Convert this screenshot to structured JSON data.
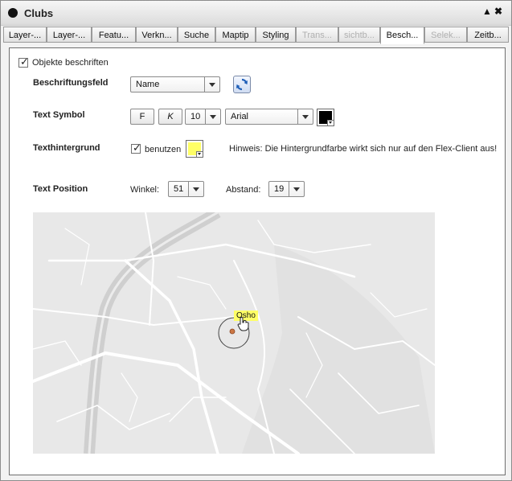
{
  "window": {
    "title": "Clubs",
    "btn_collapse": "▲",
    "btn_close": "✖"
  },
  "tabs": [
    {
      "label": "Layer-...",
      "state": "normal"
    },
    {
      "label": "Layer-...",
      "state": "normal"
    },
    {
      "label": "Featu...",
      "state": "normal"
    },
    {
      "label": "Verkn...",
      "state": "normal"
    },
    {
      "label": "Suche",
      "state": "normal"
    },
    {
      "label": "Maptip",
      "state": "normal"
    },
    {
      "label": "Styling",
      "state": "normal"
    },
    {
      "label": "Trans...",
      "state": "disabled"
    },
    {
      "label": "sichtb...",
      "state": "disabled"
    },
    {
      "label": "Besch...",
      "state": "active"
    },
    {
      "label": "Selek...",
      "state": "disabled"
    },
    {
      "label": "Zeitb...",
      "state": "normal"
    }
  ],
  "form": {
    "objekte_beschriften": {
      "label": "Objekte beschriften",
      "checked": true
    },
    "beschriftungsfeld": {
      "label": "Beschriftungsfeld",
      "value": "Name"
    },
    "text_symbol": {
      "label": "Text Symbol",
      "bold": "F",
      "italic": "K",
      "size": "10",
      "font": "Arial",
      "color": "#000000"
    },
    "texthintergrund": {
      "label": "Texthintergrund",
      "use_label": "benutzen",
      "checked": true,
      "color": "#ffff66",
      "hint": "Hinweis: Die Hintergrundfarbe wirkt sich nur auf den Flex-Client aus!"
    },
    "text_position": {
      "label": "Text Position",
      "winkel_label": "Winkel:",
      "winkel": "51",
      "abstand_label": "Abstand:",
      "abstand": "19"
    }
  },
  "preview": {
    "label_text": "Osho"
  }
}
